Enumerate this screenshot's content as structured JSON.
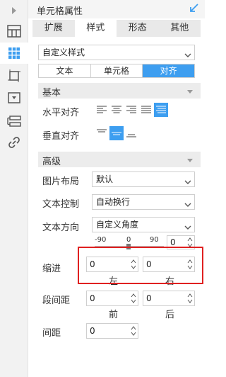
{
  "panel": {
    "title": "单元格属性",
    "tabs": [
      "扩展",
      "样式",
      "形态",
      "其他"
    ],
    "active_tab": "样式"
  },
  "style_select": {
    "value": "自定义样式"
  },
  "sub_tabs": [
    "文本",
    "单元格",
    "对齐"
  ],
  "active_sub_tab": "对齐",
  "sections": {
    "basic": "基本",
    "advanced": "高级"
  },
  "labels": {
    "h_align": "水平对齐",
    "v_align": "垂直对齐",
    "image_layout": "图片布局",
    "text_control": "文本控制",
    "text_direction": "文本方向",
    "indent": "缩进",
    "paragraph_spacing": "段间距",
    "line_spacing": "间距"
  },
  "image_layout": {
    "value": "默认"
  },
  "text_control": {
    "value": "自动换行"
  },
  "text_direction": {
    "value": "自定义角度"
  },
  "angle": {
    "ticks": [
      "-90",
      "0",
      "90"
    ],
    "value": "0"
  },
  "indent": {
    "left": "0",
    "right": "0",
    "left_label": "左",
    "right_label": "右"
  },
  "paragraph": {
    "before": "0",
    "after": "0",
    "before_label": "前",
    "after_label": "后"
  },
  "line_spacing": {
    "value": "0"
  },
  "colors": {
    "accent": "#3d9ef0",
    "highlight": "#e02020"
  },
  "icons": [
    "chevron-right-icon",
    "grid-icon",
    "cell-icon",
    "border-icon",
    "widget-icon",
    "condition-icon",
    "link-icon",
    "pin-icon"
  ]
}
